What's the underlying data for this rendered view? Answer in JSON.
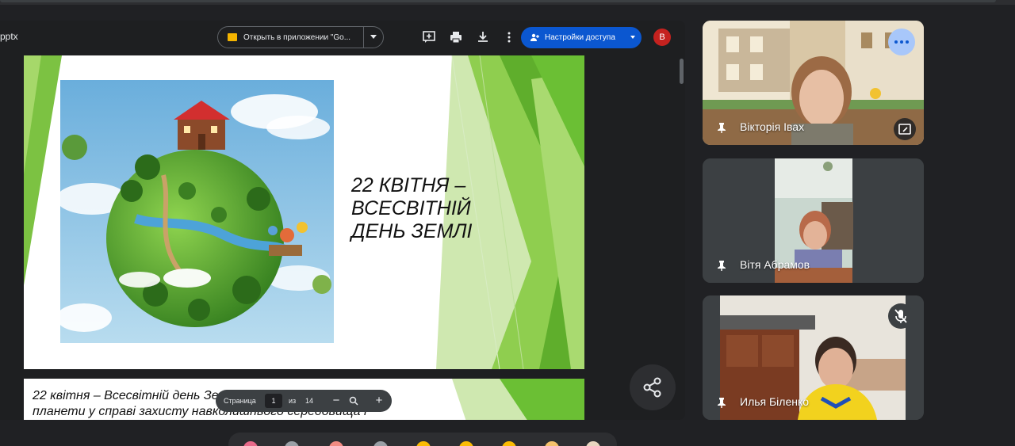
{
  "toolbar": {
    "filename": "pptx",
    "open_in_app": "Открыть в приложении \"Go...",
    "access_settings": "Настройки доступа",
    "avatar_letter": "В"
  },
  "slides": {
    "slide1_title": [
      "22 КВІТНЯ –",
      "ВСЕСВІТНІЙ",
      "ДЕНЬ ЗЕМЛІ"
    ],
    "slide2_text": [
      "22 квітня – Всесвітній день Землі, свято єднання народів",
      "планети у справі захисту навколишнього середовища і"
    ]
  },
  "page_control": {
    "label": "Страница",
    "current": "1",
    "of": "из",
    "total": "14",
    "minus": "−",
    "plus": "+"
  },
  "participants": [
    {
      "name": "Вікторія Івах",
      "pinned": true
    },
    {
      "name": "Вітя Абрамов",
      "pinned": true
    },
    {
      "name": "Илья Біленко",
      "pinned": true,
      "muted": true
    }
  ],
  "colors": {
    "background": "#202124",
    "accent_blue": "#0b57d0",
    "slide_green": "#7cc242",
    "avatar_red": "#c5221f"
  }
}
